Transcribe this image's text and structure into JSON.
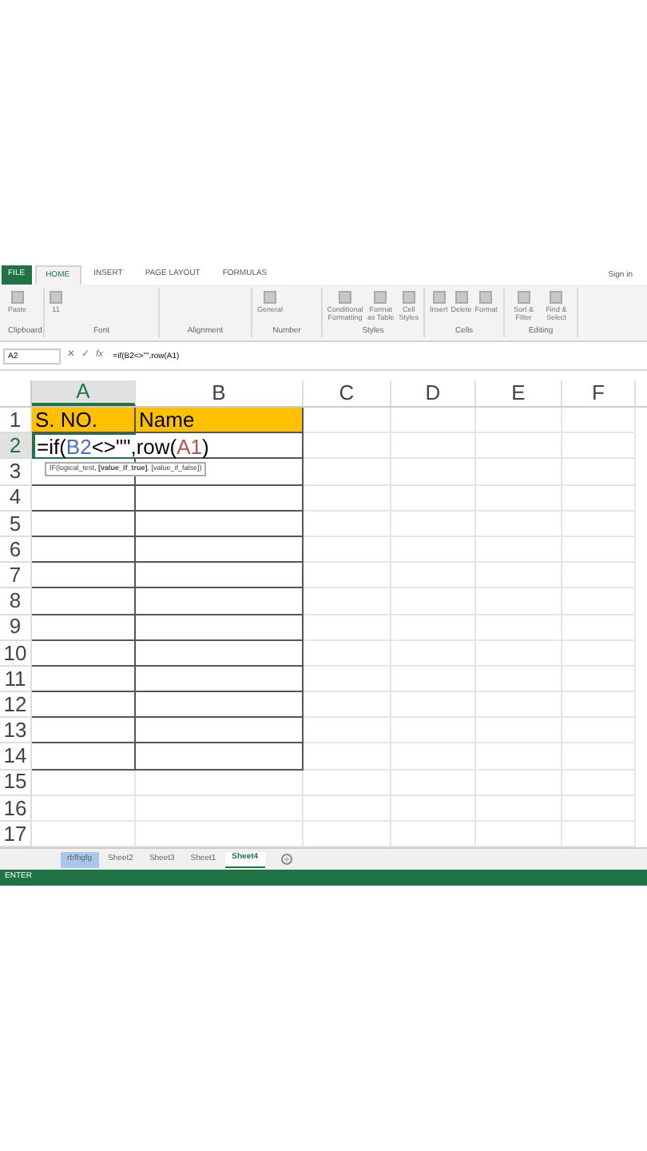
{
  "ribbon": {
    "tabs": [
      {
        "label": "FILE",
        "kind": "file",
        "selected": false
      },
      {
        "label": "HOME",
        "kind": "tab",
        "selected": true
      },
      {
        "label": "INSERT",
        "kind": "tab",
        "selected": false
      },
      {
        "label": "PAGE LAYOUT",
        "kind": "tab",
        "selected": false
      },
      {
        "label": "FORMULAS",
        "kind": "tab",
        "selected": false
      }
    ],
    "sign_in": "Sign in",
    "groups": [
      {
        "name": "Clipboard",
        "items": [
          "Paste"
        ]
      },
      {
        "name": "Font",
        "items": [
          "11"
        ]
      },
      {
        "name": "Alignment"
      },
      {
        "name": "Number",
        "items": [
          "General"
        ]
      },
      {
        "name": "Styles",
        "items": [
          "Conditional Formatting",
          "Format as Table",
          "Cell Styles"
        ]
      },
      {
        "name": "Cells",
        "items": [
          "Insert",
          "Delete",
          "Format"
        ]
      },
      {
        "name": "Editing",
        "items": [
          "Sort & Filter",
          "Find & Select"
        ]
      }
    ]
  },
  "formula_bar": {
    "name_box": "A2",
    "buttons": [
      "✕",
      "✓",
      "fx"
    ],
    "formula": "=if(B2<>\"\",row(A1)"
  },
  "sheet": {
    "columns": [
      {
        "label": "A",
        "selected": true
      },
      {
        "label": "B",
        "selected": false
      },
      {
        "label": "C",
        "selected": false
      },
      {
        "label": "D",
        "selected": false
      },
      {
        "label": "E",
        "selected": false
      },
      {
        "label": "F",
        "selected": false
      }
    ],
    "rows": [
      {
        "label": "1",
        "selected": false,
        "cells": [
          "S. NO.",
          "Name"
        ]
      },
      {
        "label": "2",
        "selected": true,
        "editing": true,
        "cells": []
      },
      {
        "label": "3",
        "selected": false,
        "cells": []
      },
      {
        "label": "4",
        "selected": false,
        "cells": []
      },
      {
        "label": "5",
        "selected": false,
        "cells": []
      },
      {
        "label": "6",
        "selected": false,
        "cells": []
      },
      {
        "label": "7",
        "selected": false,
        "cells": []
      },
      {
        "label": "8",
        "selected": false,
        "cells": []
      },
      {
        "label": "9",
        "selected": false,
        "cells": []
      },
      {
        "label": "10",
        "selected": false,
        "cells": []
      },
      {
        "label": "11",
        "selected": false,
        "cells": []
      },
      {
        "label": "12",
        "selected": false,
        "cells": []
      },
      {
        "label": "13",
        "selected": false,
        "cells": []
      },
      {
        "label": "14",
        "selected": false,
        "cells": []
      },
      {
        "label": "15",
        "selected": false,
        "cells": []
      },
      {
        "label": "16",
        "selected": false,
        "cells": []
      },
      {
        "label": "17",
        "selected": false,
        "cells": []
      }
    ],
    "editing_parts": [
      {
        "text": "=if(",
        "color": "#000000"
      },
      {
        "text": "B2",
        "color": "#4472c4"
      },
      {
        "text": "<>\"\",row(",
        "color": "#000000"
      },
      {
        "text": "A1",
        "color": "#c0504d"
      },
      {
        "text": ")",
        "color": "#000000"
      }
    ],
    "tooltip": "IF(logical_test, **[value_if_true]**, [value_if_false])"
  },
  "sheet_tabs": [
    {
      "label": "rbfhgfg",
      "selected": false,
      "highlighted": true
    },
    {
      "label": "Sheet2",
      "selected": false,
      "highlighted": false
    },
    {
      "label": "Sheet3",
      "selected": false,
      "highlighted": false
    },
    {
      "label": "Sheet1",
      "selected": false,
      "highlighted": false
    },
    {
      "label": "Sheet4",
      "selected": true,
      "highlighted": false
    }
  ],
  "status_bar": {
    "mode": "ENTER"
  }
}
